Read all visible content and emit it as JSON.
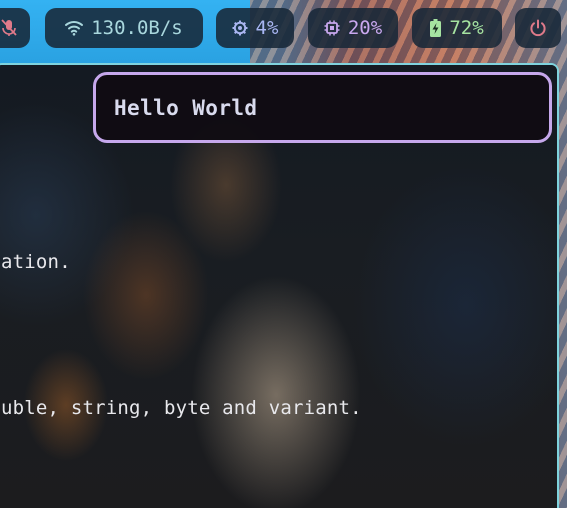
{
  "statusbar": {
    "mic": {
      "icon": "mic-muted-icon",
      "color": "#e07a8a"
    },
    "network": {
      "icon": "wifi-icon",
      "speed": "130.0B/s",
      "color": "#a9d7dd"
    },
    "cpu": {
      "icon": "cpu-icon",
      "value": "4%",
      "color": "#a9b6f2"
    },
    "memory": {
      "icon": "memory-chip-icon",
      "value": "20%",
      "color": "#c9a8ef"
    },
    "battery": {
      "icon": "battery-charging-icon",
      "value": "72%",
      "color": "#a6e3a1"
    },
    "power": {
      "icon": "power-icon",
      "color": "#e07a8a"
    }
  },
  "terminal": {
    "lines": [
      "ation.",
      "uble, string, byte and variant."
    ]
  },
  "notification": {
    "title": "Hello World"
  },
  "colors": {
    "window_border": "#7fd3de",
    "popup_border": "#c6a8ec"
  }
}
